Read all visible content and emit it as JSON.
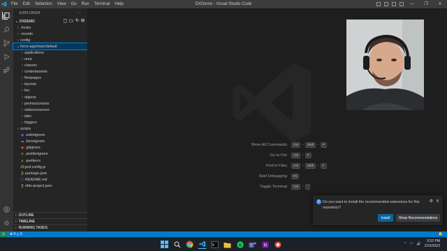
{
  "titlebar": {
    "menu": [
      "File",
      "Edit",
      "Selection",
      "View",
      "Go",
      "Run",
      "Terminal",
      "Help"
    ],
    "title": "DXDemo - Visual Studio Code",
    "controls": [
      "—",
      "❐",
      "✕"
    ]
  },
  "explorer": {
    "header": "EXPLORER",
    "more": "···",
    "project": "DXDEMO",
    "tree": [
      {
        "name": ".husky",
        "level": 1,
        "type": "folder",
        "expanded": false
      },
      {
        "name": ".vscode",
        "level": 1,
        "type": "folder",
        "expanded": false
      },
      {
        "name": "config",
        "level": 1,
        "type": "folder",
        "expanded": false
      },
      {
        "name": "force-app",
        "branch": "main/default",
        "level": 1,
        "type": "folder",
        "expanded": true,
        "selected": true
      },
      {
        "name": "applications",
        "level": 2,
        "type": "folder",
        "expanded": false
      },
      {
        "name": "aura",
        "level": 2,
        "type": "folder",
        "expanded": false
      },
      {
        "name": "classes",
        "level": 2,
        "type": "folder",
        "expanded": false
      },
      {
        "name": "contentassets",
        "level": 2,
        "type": "folder",
        "expanded": false
      },
      {
        "name": "flexipages",
        "level": 2,
        "type": "folder",
        "expanded": false
      },
      {
        "name": "layouts",
        "level": 2,
        "type": "folder",
        "expanded": false
      },
      {
        "name": "lwc",
        "level": 2,
        "type": "folder",
        "expanded": false
      },
      {
        "name": "objects",
        "level": 2,
        "type": "folder",
        "expanded": false
      },
      {
        "name": "permissionsets",
        "level": 2,
        "type": "folder",
        "expanded": false
      },
      {
        "name": "staticresources",
        "level": 2,
        "type": "folder",
        "expanded": false
      },
      {
        "name": "tabs",
        "level": 2,
        "type": "folder",
        "expanded": false
      },
      {
        "name": "triggers",
        "level": 2,
        "type": "folder",
        "expanded": false
      },
      {
        "name": "scripts",
        "level": 1,
        "type": "folder",
        "expanded": false
      },
      {
        "name": ".eslintignore",
        "level": 1,
        "type": "file",
        "icon": "◉",
        "color": "#8b5cf6"
      },
      {
        "name": ".forceignore",
        "level": 1,
        "type": "file",
        "icon": "☁",
        "color": "#4aa3df"
      },
      {
        "name": ".gitignore",
        "level": 1,
        "type": "file",
        "icon": "◆",
        "color": "#e8533c"
      },
      {
        "name": ".prettierignore",
        "level": 1,
        "type": "file",
        "icon": "≡",
        "color": "#f0c040"
      },
      {
        "name": ".prettierrc",
        "level": 1,
        "type": "file",
        "icon": "≡",
        "color": "#f0c040"
      },
      {
        "name": "jest.config.js",
        "level": 1,
        "type": "file",
        "icon": "JS",
        "color": "#e8d44d"
      },
      {
        "name": "package.json",
        "level": 1,
        "type": "file",
        "icon": "{}",
        "color": "#e8d44d"
      },
      {
        "name": "README.md",
        "level": 1,
        "type": "file",
        "icon": "ⓘ",
        "color": "#42a5f5"
      },
      {
        "name": "sfdx-project.json",
        "level": 1,
        "type": "file",
        "icon": "{}",
        "color": "#e8d44d"
      }
    ],
    "sections": [
      "OUTLINE",
      "TIMELINE",
      "RUNNING TASKS"
    ]
  },
  "welcome": {
    "shortcuts": [
      {
        "label": "Show All Commands",
        "keys": [
          "Ctrl",
          "Shift",
          "P"
        ]
      },
      {
        "label": "Go to File",
        "keys": [
          "Ctrl",
          "P"
        ]
      },
      {
        "label": "Find in Files",
        "keys": [
          "Ctrl",
          "Shift",
          "F"
        ]
      },
      {
        "label": "Start Debugging",
        "keys": [
          "F5"
        ]
      },
      {
        "label": "Toggle Terminal",
        "keys": [
          "Ctrl",
          "`"
        ]
      }
    ]
  },
  "notification": {
    "message": "Do you want to install the recommended extensions for this repository?",
    "install_label": "Install",
    "show_label": "Show Recommendations"
  },
  "statusbar": {
    "problems": "⊗ 0 △ 0"
  },
  "taskbar": {
    "time": "5:52 PM",
    "date": "2/15/2023",
    "colors": {
      "start": "#4cc2ff",
      "vscode": "#23a9f2",
      "chrome": "#ea4335"
    }
  }
}
